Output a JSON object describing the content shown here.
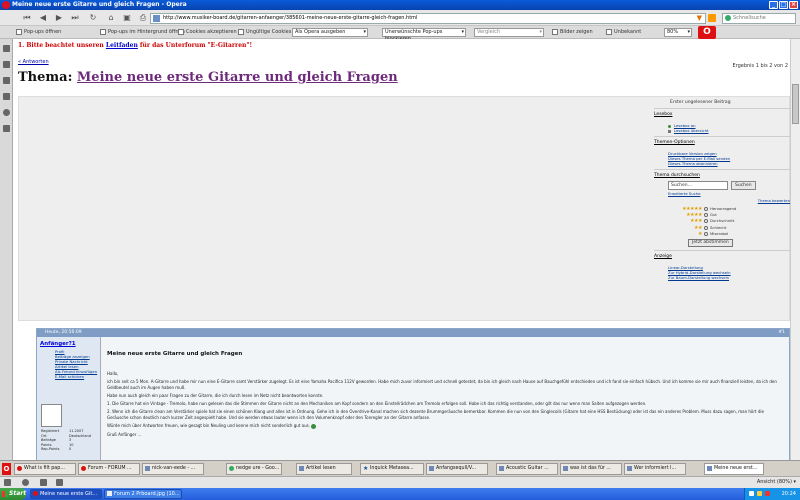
{
  "window": {
    "title": "Meine neue erste Gitarre und gleich Fragen - Opera"
  },
  "toolbar": {
    "url": "http://www.musiker-board.de/gitarren-anfaenger/385601-meine-neue-erste-gitarre-gleich-fragen.html",
    "search_placeholder": "Schnellsuche"
  },
  "toolbar2": {
    "items": [
      "Pop-ups öffnen",
      "Pop-ups im Hintergrund öffnen",
      "Cookies akzeptieren",
      "Ungültige Cookies"
    ],
    "select1": "Als Opera ausgeben",
    "select2": "Unerwünschte Pop-ups blockieren",
    "search_field": "Vergleich",
    "images": "Bilder zeigen",
    "unknown": "Unbekannt",
    "zoom": "80%"
  },
  "page": {
    "notice_prefix": "1. Bitte beachtet unseren ",
    "notice_link": "Leitfaden",
    "notice_suffix": " für das Unterforum \"E-Gitarren\"!",
    "reply_link": "« Antworten",
    "pager": "Ergebnis 1 bis 2 von 2",
    "thema_label": "Thema: ",
    "thema_title": "Meine neue erste Gitarre und gleich Fragen"
  },
  "sidebar": {
    "header": "Erster ungelesener Beitrag",
    "sections": [
      {
        "title": "Lesebox",
        "links": [
          "Lesebox an",
          "Lesebox übersicht"
        ]
      },
      {
        "title": "Themen-Optionen",
        "links": [
          "Druckbare Version zeigen",
          "Dieses Thema per E-Mail senden",
          "Dieses Thema abonnieren"
        ]
      },
      {
        "title": "Thema durchsuchen",
        "links": []
      },
      {
        "title": "Anzeige",
        "links": [
          "Linear-Darstellung",
          "Zur Hybrid-Darstellung wechseln",
          "Zur Baum-Darstellung wechseln"
        ]
      }
    ],
    "search_value": "Suchen...",
    "search_button": "Suchen",
    "advanced_search": "Erweiterte Suche",
    "rate_title": "Thema bewerten",
    "rating_options": [
      "Hervorragend",
      "Gut",
      "Durchschnitt",
      "Schlecht",
      "Miserabel"
    ],
    "vote_button": "Jetzt abstimmen"
  },
  "post": {
    "header_date": "Heute, 20:56:09",
    "post_number": "#1",
    "username": "Anfänger?1",
    "user_menu": [
      "Profil",
      "Beiträge anzeigen",
      "Private Nachricht",
      "Artikel lesen",
      "Als Freund hinzufügen",
      "E-Mail schicken"
    ],
    "user_stats": [
      {
        "k": "Registriert",
        "v": "11.2007"
      },
      {
        "k": "Ort",
        "v": "Deutschland"
      },
      {
        "k": "Beiträge",
        "v": "3"
      },
      {
        "k": "Points",
        "v": "10"
      },
      {
        "k": "Rep-Points",
        "v": "0"
      }
    ],
    "title": "Meine neue erste Gitarre und gleich Fragen",
    "body": [
      "Hallo,",
      "ich bin seit ca 5 Mon. A-Gitarre und habe mir nun eine E-Gitarre samt Verstärker zugelegt. Es ist eine Yamaha Pacifica 112V geworden. Habe mich zuvor informiert und schnell getestet, da bin ich gleich nach Hause auf Bauchgefühl entschieden und ich fand sie einfach hübsch. Und ich komme sie mir auch finanziell leisten, da ich den Geldbeutel auch im Augen haben muß.",
      "Habe nun auch gleich ein paar Fragen zu der Gitarre, die ich durch lesen im Netz nicht beantworten konnte.",
      "1. Die Gitarre hat ein Vintage - Tremolo, habe nun gelesen das die Stimmen der Gitarre nicht an den Mechaniken am Kopf sondern an den Einstellrädchen am Tremolo erfolgen soll. Habe ich das richtig verstanden, oder gilt das nur wenn man Saiten aufgezogen werden.",
      "2. Wenn ich die Gitarre clean am Verstärker spiele hat sie einen schönen Klang und alles ist in Ordnung. Gehe ich in den Overdrive-Kanal machen sich dezente Brummgeräusche bemerkbar. Kommen die nun von den Singlecoils (Gitarre hat eine HSS Bestückung) oder ist das ein anderes Problem. Muss dazu sagen, man hört die Geräusche schon deutlich nach kurzer Zeit angespielt habe. Und sie werden etwas lauter wenn ich den Volumenknopf oder den Tonregler an der Gitarre anfasse.",
      "Würde mich über Antworten freuen, wie gesagt bin Neuling und kenne mich nicht sonderlich gut aus.",
      "Gruß Anfänger ..."
    ]
  },
  "tabs": [
    {
      "label": "What is filt pap...",
      "icon": "o"
    },
    {
      "label": "Forum - FORUM ...",
      "icon": "o"
    },
    {
      "label": "nick-van-eede - ...",
      "icon": "p"
    },
    {
      "label": "nedge ure - Goo...",
      "icon": "g"
    },
    {
      "label": "Artikel lesen",
      "icon": "p"
    },
    {
      "label": "Inquick Metasea...",
      "icon": "s"
    },
    {
      "label": "Anfangsequll/V...",
      "icon": "p"
    },
    {
      "label": "Acoustic Guitar ...",
      "icon": "p"
    },
    {
      "label": "was ist das für ...",
      "icon": "p"
    },
    {
      "label": "Wer informiert l...",
      "icon": "p"
    },
    {
      "label": "Meine neue erst...",
      "icon": "p",
      "active": true
    }
  ],
  "statusbar": {
    "zoom": "Ansicht (80%) ▾"
  },
  "taskbar": {
    "start": "Start",
    "tasks": [
      {
        "label": "Meine neue erste Git...",
        "active": true
      },
      {
        "label": "Forum 2 Prboard.jpg (10..."
      }
    ],
    "clock": "20:24"
  },
  "colors": {
    "title_bar": "#0a5ad8",
    "notice": "#cc0000",
    "thema_link": "#6d2a7a",
    "post_header": "#7f9cc4",
    "taskbar": "#245ddb",
    "start_button": "#2f8a33"
  }
}
